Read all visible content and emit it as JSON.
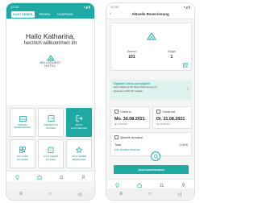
{
  "left_screen": {
    "status": {
      "time": "12:00",
      "icons": "▾◢ ▮"
    },
    "tabs": [
      {
        "label": "GASTGEBER",
        "active": true
      },
      {
        "label": "PROFIL",
        "active": false
      },
      {
        "label": "COUPONS",
        "active": false
      }
    ],
    "greeting_line1": "Hallo Katharina,",
    "greeting_line2": "herzlich willkommen im",
    "logo_name": "HELLOGUEST",
    "logo_sub": "HOTEL",
    "tiles": [
      {
        "label": "ZIMMER\nRESERVIEREN",
        "icon": "bed-icon"
      },
      {
        "label": "ZIMMERTÜR\nÖFFNEN",
        "icon": "door-key-icon"
      },
      {
        "label": "JETZT\nAUSCHECKEN",
        "icon": "logout-icon"
      },
      {
        "label": "QR-CODE\nSCANNEN",
        "icon": "qr-code-icon"
      },
      {
        "label": "GASTGEBER\nNUTZEN",
        "icon": "building-icon"
      },
      {
        "label": "GASTGEBER\nBEWERTEN",
        "icon": "star-icon"
      }
    ]
  },
  "right_screen": {
    "status": {
      "time": "12:00",
      "icons": "▾◢ ▮"
    },
    "title": "Aktuelle Reservierung",
    "room_label": "Zimmer",
    "room_value": "101",
    "floor_label": "Etage",
    "floor_value": "1",
    "info_title": "Digitaler Check-out möglich",
    "info_line1": "Dein Check-out für diese Reservierung ist",
    "info_line2": "heute bis 12:00 Uhr möglich.",
    "checkin_label": "Check in",
    "checkin_date": "Mo. 30.08.2021",
    "checkin_time": "ab 14:00 Uhr",
    "checkout_label": "Check out",
    "checkout_date": "Di. 31.08.2021",
    "checkout_time": "bis 12:00 Uhr",
    "umsatz_label": "Aktuelle Umsätze",
    "total_label": "Total",
    "total_value": "0,00 €",
    "umsatz_link": "Alle Umsätze ansehen",
    "cta_label": "Jetzt auschecken"
  },
  "colors": {
    "brand": "#1fa9a4",
    "info_bg": "#def2ef"
  }
}
